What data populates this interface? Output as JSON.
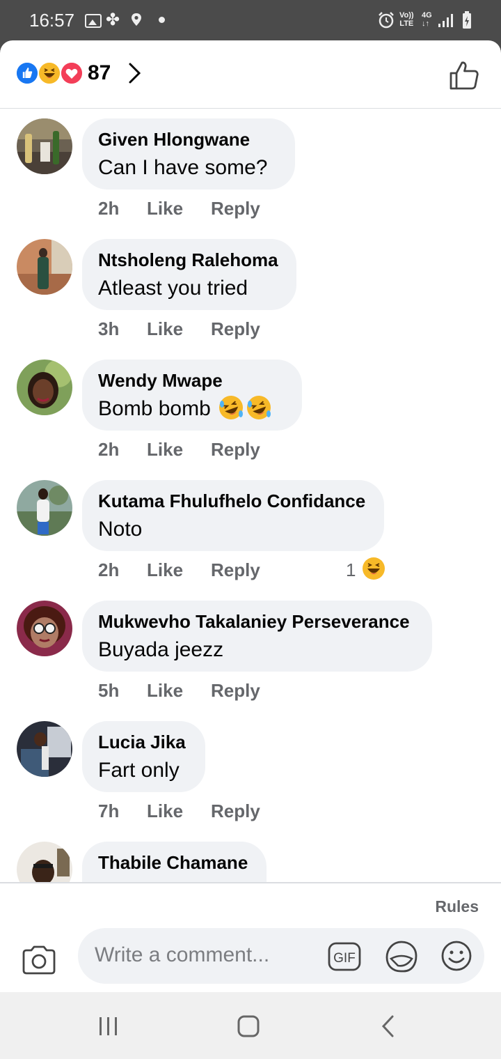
{
  "status_bar": {
    "time": "16:57",
    "icons": [
      "gallery-icon",
      "pinwheel-icon",
      "location-pin-icon",
      "dot-icon",
      "alarm-icon",
      "volte-icon",
      "4g-icon",
      "signal-icon",
      "battery-icon"
    ],
    "volte_label_1": "Vo))",
    "volte_label_2": "LTE",
    "network_label": "4G"
  },
  "header": {
    "reaction_icons": [
      "like-reaction-icon",
      "haha-reaction-icon",
      "love-reaction-icon"
    ],
    "reaction_count": "87"
  },
  "comments": [
    {
      "author": "Given Hlongwane",
      "text": "Can I have some?",
      "emoji_count": 0,
      "time": "2h",
      "like_label": "Like",
      "reply_label": "Reply"
    },
    {
      "author": "Ntsholeng Ralehoma",
      "text": "Atleast you tried",
      "emoji_count": 0,
      "time": "3h",
      "like_label": "Like",
      "reply_label": "Reply"
    },
    {
      "author": "Wendy Mwape",
      "text": "Bomb bomb",
      "emoji_count": 2,
      "time": "2h",
      "like_label": "Like",
      "reply_label": "Reply"
    },
    {
      "author": "Kutama Fhulufhelo Confidance",
      "text": "Noto",
      "emoji_count": 0,
      "time": "2h",
      "like_label": "Like",
      "reply_label": "Reply",
      "reaction_count": "1"
    },
    {
      "author": "Mukwevho Takalaniey Perseverance",
      "text": "Buyada jeezz",
      "emoji_count": 0,
      "time": "5h",
      "like_label": "Like",
      "reply_label": "Reply"
    },
    {
      "author": "Lucia Jika",
      "text": "Fart only",
      "emoji_count": 0,
      "time": "7h",
      "like_label": "Like",
      "reply_label": "Reply"
    },
    {
      "author": "Thabile Chamane",
      "text": "",
      "emoji_count": 0,
      "time": "",
      "like_label": "",
      "reply_label": ""
    }
  ],
  "footer": {
    "rules_label": "Rules",
    "comment_placeholder": "Write a comment...",
    "gif_label": "GIF"
  },
  "colors": {
    "like_blue": "#1877f2",
    "haha_yellow": "#f7b928",
    "love_red": "#f33e58",
    "bubble_bg": "#f0f2f5",
    "meta_grey": "#65676b"
  }
}
